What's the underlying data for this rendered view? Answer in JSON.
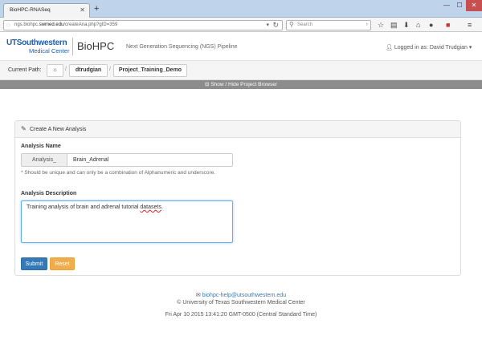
{
  "browser": {
    "tab_title": "BioHPC-RNASeq",
    "new_tab": "+",
    "window_controls": {
      "minimize": "—",
      "maximize": "☐",
      "close": "✕"
    },
    "url_prefix": "ngs.biohpc.",
    "url_domain": "swmed.edu",
    "url_path": "/createAna.php?gID=359",
    "search_placeholder": "Search",
    "toolbar_icons": [
      "star-icon",
      "clipboard-icon",
      "download-icon",
      "home-icon",
      "chat-icon",
      "block-icon",
      "menu-icon"
    ]
  },
  "header": {
    "logo_ut": "UTSouthwestern",
    "logo_mc": "Medical Center",
    "logo_biohpc": "BioHPC",
    "subtitle": "Next Generation Sequencing (NGS) Pipeline",
    "login_text": "Logged in as: David Trudgian"
  },
  "breadcrumb": {
    "label": "Current Path:",
    "items": [
      "dtrudgian",
      "Project_Training_Demo"
    ]
  },
  "project_browser_toggle": "Show / Hide Project Browser",
  "panel": {
    "title": "Create A New Analysis",
    "name_label": "Analysis Name",
    "name_prefix": "Analysis_",
    "name_value": "Brain_Adrenal",
    "name_help": "* Should be unique and can only be a combination of Alphanumeric and underscore.",
    "desc_label": "Analysis Description",
    "desc_value_main": "Training analysis of brain and adrenal tutorial ",
    "desc_value_misspelled": "datasets",
    "desc_value_end": ".",
    "submit_label": "Submit",
    "reset_label": "Reset"
  },
  "footer": {
    "email": "biohpc-help@utsouthwestern.edu",
    "copyright": "© University of Texas Southwestern Medical Center",
    "timestamp": "Fri Apr 10 2015 13:41:20 GMT-0500 (Central Standard Time)"
  },
  "colors": {
    "primary": "#337ab7",
    "warning": "#f0ad4e",
    "brand": "#1e5fa8"
  }
}
